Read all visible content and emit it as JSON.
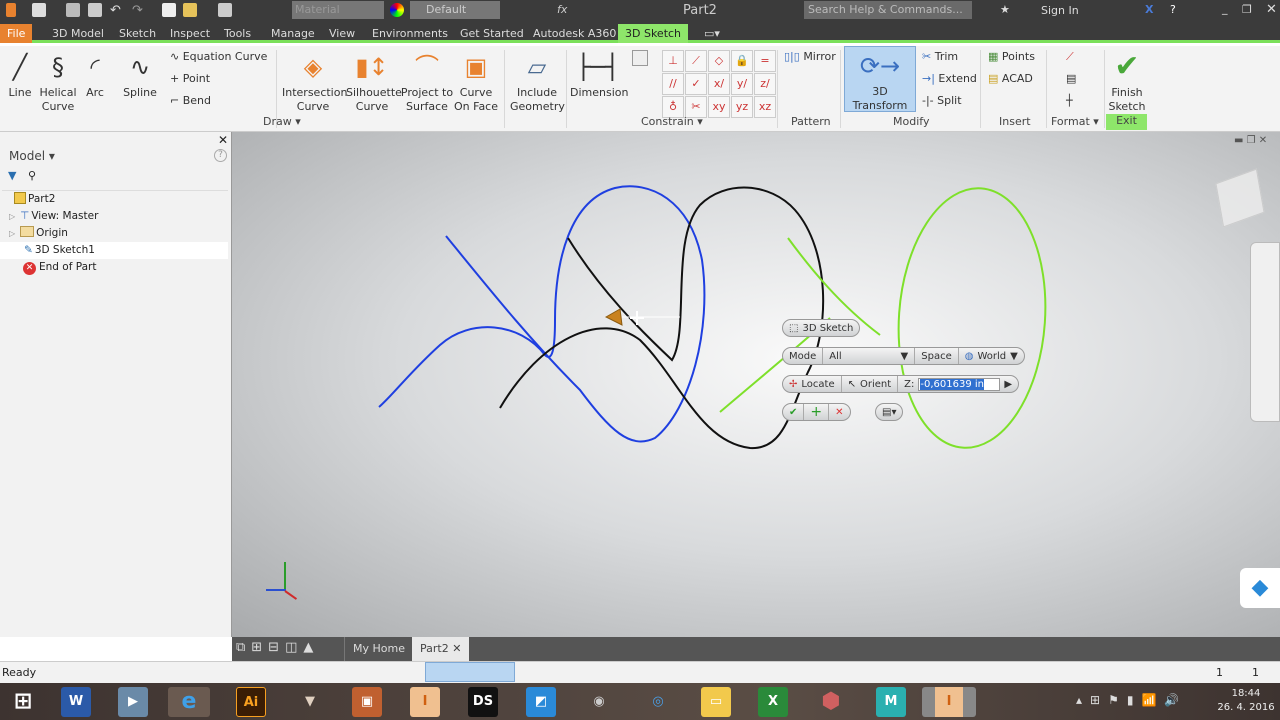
{
  "window": {
    "title": "Part2",
    "search_placeholder": "Search Help & Commands...",
    "sign_in": "Sign In",
    "material": "Material",
    "appearance": "Default"
  },
  "menu": {
    "tabs": [
      "File",
      "3D Model",
      "Sketch",
      "Inspect",
      "Tools",
      "Manage",
      "View",
      "Environments",
      "Get Started",
      "Autodesk A360",
      "3D Sketch"
    ],
    "active": "3D Sketch"
  },
  "ribbon": {
    "draw": {
      "line": "Line",
      "helical": "Helical Curve",
      "arc": "Arc",
      "spline": "Spline",
      "equation": "Equation Curve",
      "point": "Point",
      "bend": "Bend",
      "intersection": "Intersection Curve",
      "silhouette": "Silhouette Curve",
      "project": "Project to Surface",
      "curve_on_face": "Curve On Face",
      "include": "Include Geometry",
      "label": "Draw"
    },
    "dimension": "Dimension",
    "constrain_label": "Constrain",
    "pattern": {
      "mirror": "Mirror",
      "label": "Pattern"
    },
    "modify": {
      "transform": "3D Transform",
      "trim": "Trim",
      "extend": "Extend",
      "split": "Split",
      "label": "Modify"
    },
    "insert": {
      "points": "Points",
      "acad": "ACAD",
      "label": "Insert"
    },
    "format_label": "Format",
    "exit": {
      "finish": "Finish Sketch",
      "label": "Exit"
    }
  },
  "browser": {
    "title": "Model",
    "items": [
      {
        "label": "Part2",
        "icon": "part-icon"
      },
      {
        "label": "View: Master",
        "icon": "view-icon"
      },
      {
        "label": "Origin",
        "icon": "folder-icon"
      },
      {
        "label": "3D Sketch1",
        "icon": "sketch-icon"
      },
      {
        "label": "End of Part",
        "icon": "end-of-part-icon"
      }
    ]
  },
  "minitoolbar": {
    "header": "3D Sketch",
    "mode": "Mode",
    "mode_value": "All",
    "space": "Space",
    "space_value": "World",
    "locate": "Locate",
    "orient": "Orient",
    "z_label": "Z:",
    "z_value": "-0,601639 in"
  },
  "doctabs": {
    "home": "My Home",
    "part": "Part2"
  },
  "status": {
    "text": "Ready",
    "count1": "1",
    "count2": "1"
  },
  "taskbar": {
    "time": "18:44",
    "date": "26. 4. 2016"
  },
  "colors": {
    "accent": "#8ee66a",
    "file": "#e8822f",
    "curve_blue": "#1f3fe0",
    "curve_green": "#7ee02a"
  }
}
